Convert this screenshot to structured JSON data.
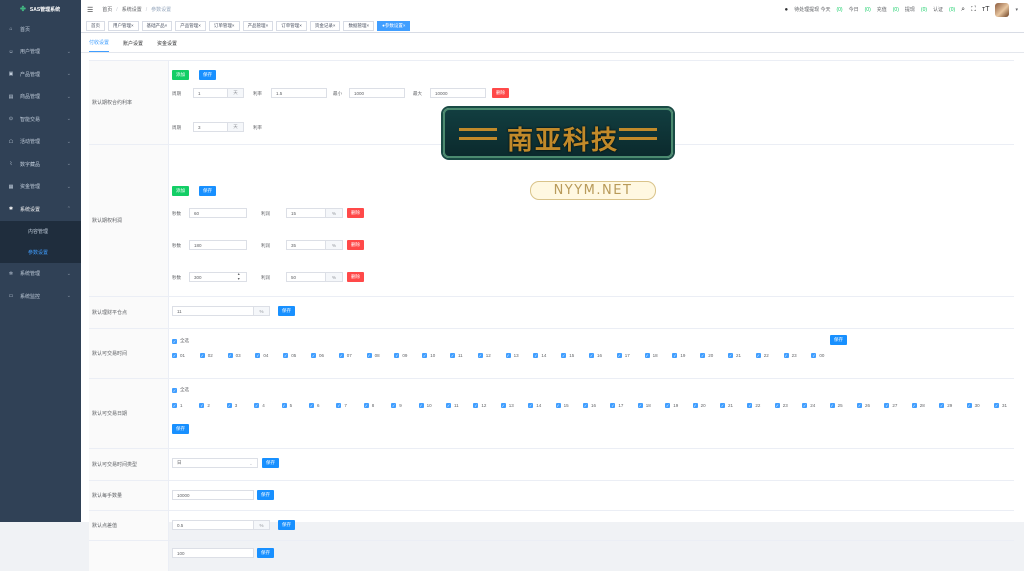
{
  "sidebar": {
    "logo": "SAS管理系统",
    "items": [
      {
        "label": "首页",
        "icon": "home-icon",
        "glyph": "⌂",
        "arrow": false
      },
      {
        "label": "用户管理",
        "icon": "user-icon",
        "glyph": "☺",
        "arrow": true
      },
      {
        "label": "产品管理",
        "icon": "product-icon",
        "glyph": "▣",
        "arrow": true
      },
      {
        "label": "商品管理",
        "icon": "goods-icon",
        "glyph": "▤",
        "arrow": true
      },
      {
        "label": "智能交易",
        "icon": "trade-icon",
        "glyph": "⊙",
        "arrow": true
      },
      {
        "label": "活动管理",
        "icon": "activity-icon",
        "glyph": "☖",
        "arrow": true
      },
      {
        "label": "数字藏品",
        "icon": "collection-icon",
        "glyph": "⌇",
        "arrow": true
      },
      {
        "label": "资金管理",
        "icon": "money-icon",
        "glyph": "▦",
        "arrow": true
      },
      {
        "label": "系统设置",
        "icon": "settings-icon",
        "glyph": "✱",
        "arrow": true,
        "open": true
      }
    ],
    "sub_items": [
      {
        "label": "内容管理",
        "active": false
      },
      {
        "label": "参数设置",
        "active": true
      }
    ],
    "items_after": [
      {
        "label": "系统管理",
        "icon": "system-icon",
        "glyph": "✲",
        "arrow": true
      },
      {
        "label": "系统监控",
        "icon": "monitor-icon",
        "glyph": "▭",
        "arrow": true
      }
    ]
  },
  "navbar": {
    "breadcrumb": [
      "首页",
      "系统设置",
      "参数设置"
    ],
    "pending_label": "待处理提现 今天",
    "pending_today": "(0)",
    "today_label": "今日",
    "today_value": "(0)",
    "recharge_label": "充值",
    "recharge_value": "(0)",
    "withdraw_label": "提现",
    "withdraw_value": "(0)",
    "verify_label": "认证",
    "verify_value": "(0)"
  },
  "tags": [
    {
      "label": "首页",
      "closable": false
    },
    {
      "label": "用户管理",
      "closable": true
    },
    {
      "label": "基础产品",
      "closable": true
    },
    {
      "label": "产品管理",
      "closable": true
    },
    {
      "label": "订单管理",
      "closable": true
    },
    {
      "label": "产品管理",
      "closable": true
    },
    {
      "label": "订单管理",
      "closable": true
    },
    {
      "label": "资金记录",
      "closable": true
    },
    {
      "label": "数据管理",
      "closable": true
    },
    {
      "label": "参数设置",
      "closable": true,
      "active": true
    }
  ],
  "tabs": [
    "付收设置",
    "账户设置",
    "资金设置"
  ],
  "rows": {
    "r1": {
      "label": "默认期权合约利率",
      "add": "添加",
      "save": "保存",
      "line1": {
        "period_label": "周期",
        "period": "1",
        "period_unit": "天",
        "rate_label": "利率",
        "rate": "1.5",
        "min_label": "最小",
        "min": "1000",
        "max_label": "最大",
        "max": "10000",
        "delete": "删除"
      },
      "line2": {
        "period_label": "周期",
        "period": "3",
        "period_unit": "天",
        "rate_label": "利率"
      }
    },
    "r2": {
      "label": "默认期权利润",
      "add": "添加",
      "save": "保存",
      "lines": [
        {
          "sec_label": "秒数",
          "sec": "60",
          "profit_label": "利润",
          "profit": "15",
          "unit": "%",
          "delete": "删除"
        },
        {
          "sec_label": "秒数",
          "sec": "180",
          "profit_label": "利润",
          "profit": "35",
          "unit": "%",
          "delete": "删除"
        },
        {
          "sec_label": "秒数",
          "sec": "300",
          "profit_label": "利润",
          "profit": "50",
          "unit": "%",
          "delete": "删除"
        }
      ]
    },
    "r3": {
      "label": "默认理财平仓点",
      "value": "11",
      "unit": "%",
      "save": "保存"
    },
    "r4": {
      "label": "默认可交易时间",
      "select_all": "全选",
      "save": "保存",
      "hours": [
        "01",
        "02",
        "03",
        "04",
        "05",
        "06",
        "07",
        "08",
        "09",
        "10",
        "11",
        "12",
        "13",
        "14",
        "15",
        "16",
        "17",
        "18",
        "19",
        "20",
        "21",
        "22",
        "23",
        "00"
      ]
    },
    "r5": {
      "label": "默认可交易日期",
      "select_all": "全选",
      "save": "保存",
      "days": [
        "1",
        "2",
        "3",
        "4",
        "5",
        "6",
        "7",
        "8",
        "9",
        "10",
        "11",
        "12",
        "13",
        "14",
        "15",
        "16",
        "17",
        "18",
        "19",
        "20",
        "21",
        "22",
        "23",
        "24",
        "25",
        "26",
        "27",
        "28",
        "29",
        "30",
        "31"
      ]
    },
    "r6": {
      "label": "默认可交易时间类型",
      "value": "日",
      "save": "保存"
    },
    "r7": {
      "label": "默认每手数量",
      "value": "10000",
      "save": "保存"
    },
    "r8": {
      "label": "默认点差值",
      "value": "0.5",
      "unit": "%",
      "save": "保存"
    },
    "r9": {
      "value": "100",
      "save": "保存"
    }
  },
  "watermark": {
    "title": "南亚科技",
    "url": "NYYM.NET"
  }
}
